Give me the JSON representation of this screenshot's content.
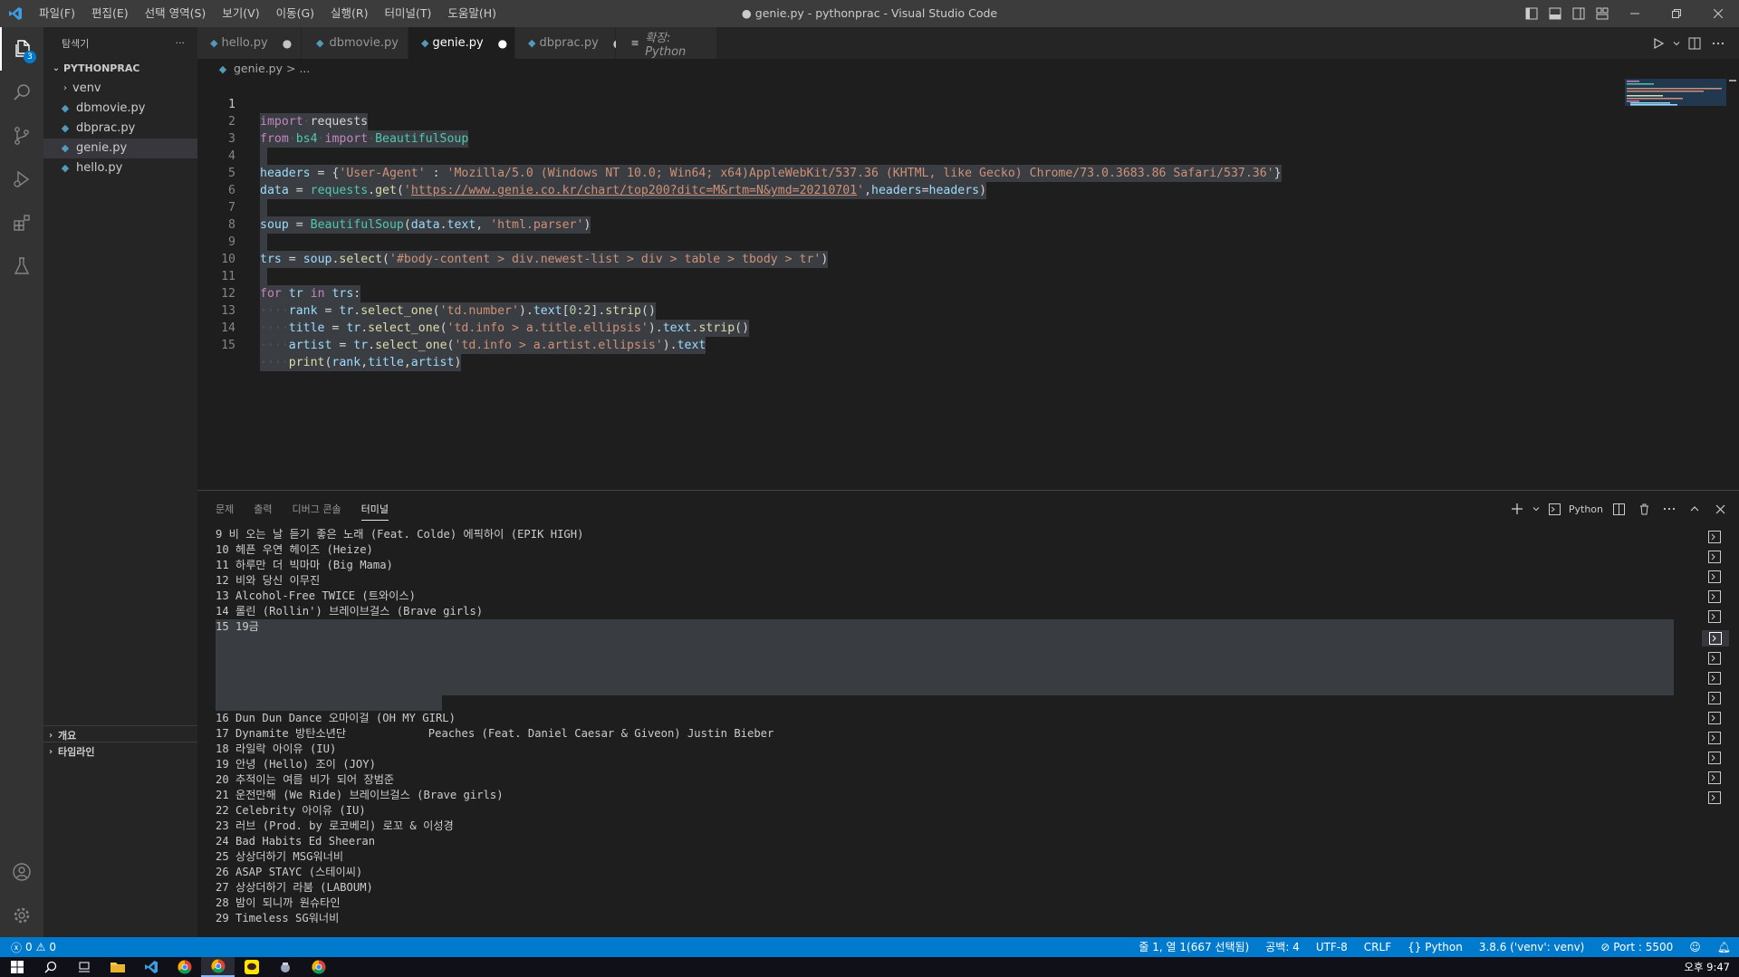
{
  "window": {
    "title": "● genie.py - pythonprac - Visual Studio Code"
  },
  "menu": [
    "파일(F)",
    "편집(E)",
    "선택 영역(S)",
    "보기(V)",
    "이동(G)",
    "실행(R)",
    "터미널(T)",
    "도움말(H)"
  ],
  "activity": {
    "explorer_badge": "3"
  },
  "sidebar": {
    "title": "탐색기",
    "more": "···",
    "root": "PYTHONPRAC",
    "items": [
      {
        "label": "venv",
        "type": "folder"
      },
      {
        "label": "dbmovie.py",
        "type": "file"
      },
      {
        "label": "dbprac.py",
        "type": "file"
      },
      {
        "label": "genie.py",
        "type": "file",
        "selected": true
      },
      {
        "label": "hello.py",
        "type": "file"
      }
    ],
    "sections": [
      "개요",
      "타임라인"
    ]
  },
  "tabs": [
    {
      "label": "hello.py",
      "dirty": true
    },
    {
      "label": "dbmovie.py",
      "dirty": false
    },
    {
      "label": "genie.py",
      "dirty": true,
      "active": true
    },
    {
      "label": "dbprac.py",
      "dirty": true
    },
    {
      "label": "확장: Python",
      "preview": true
    }
  ],
  "breadcrumb": {
    "file": "genie.py",
    "rest": " > ..."
  },
  "code": {
    "line_numbers": [
      "1",
      "2",
      "3",
      "4",
      "5",
      "6",
      "7",
      "8",
      "9",
      "10",
      "11",
      "12",
      "13",
      "14",
      "15"
    ],
    "lines": [
      "import requests",
      "from bs4 import BeautifulSoup",
      "",
      "headers = {'User-Agent' : 'Mozilla/5.0 (Windows NT 10.0; Win64; x64)AppleWebKit/537.36 (KHTML, like Gecko) Chrome/73.0.3683.86 Safari/537.36'}",
      "data = requests.get('https://www.genie.co.kr/chart/top200?ditc=M&rtm=N&ymd=20210701',headers=headers)",
      "",
      "soup = BeautifulSoup(data.text, 'html.parser')",
      "",
      "trs = soup.select('#body-content > div.newest-list > div > table > tbody > tr')",
      "",
      "for tr in trs:",
      "    rank = tr.select_one('td.number').text[0:2].strip()",
      "    title = tr.select_one('td.info > a.title.ellipsis').text.strip()",
      "    artist = tr.select_one('td.info > a.artist.ellipsis').text",
      "    print(rank,title,artist)"
    ]
  },
  "panel": {
    "tabs": [
      "문제",
      "출력",
      "디버그 콘솔",
      "터미널"
    ],
    "active_tab": "터미널",
    "terminal_label": "Python"
  },
  "terminal": {
    "lines_before": [
      "9 비 오는 날 듣기 좋은 노래 (Feat. Colde) 에픽하이 (EPIK HIGH)",
      "10 헤픈 우연 헤이즈 (Heize)",
      "11 하루만 더 빅마마 (Big Mama)",
      "12 비와 당신 이무진",
      "13 Alcohol-Free TWICE (트와이스)",
      "14 롤린 (Rollin') 브레이브걸스 (Brave girls)"
    ],
    "block_first": "15 19금",
    "block_last": "                          Peaches (Feat. Daniel Caesar & Giveon) Justin Bieber",
    "lines_after": [
      "16 Dun Dun Dance 오마이걸 (OH MY GIRL)",
      "17 Dynamite 방탄소년단",
      "18 라일락 아이유 (IU)",
      "19 안녕 (Hello) 조이 (JOY)",
      "20 추적이는 여름 비가 되어 장범준",
      "21 운전만해 (We Ride) 브레이브걸스 (Brave girls)",
      "22 Celebrity 아이유 (IU)",
      "23 러브 (Prod. by 로코베리) 로꼬 & 이성경",
      "24 Bad Habits Ed Sheeran",
      "25 상상더하기 MSG워너비",
      "26 ASAP STAYC (스테이씨)",
      "27 상상더하기 라붐 (LABOUM)",
      "28 밤이 되니까 원슈타인",
      "29 Timeless SG워너비"
    ]
  },
  "status": {
    "errors": "0",
    "warnings": "0",
    "position": "줄 1, 열 1(667 선택됨)",
    "spaces": "공백: 4",
    "encoding": "UTF-8",
    "eol": "CRLF",
    "language": "Python",
    "interpreter": "3.8.6 ('venv': venv)",
    "port": "Port : 5500"
  },
  "taskbar": {
    "clock": "오후 9:47"
  }
}
